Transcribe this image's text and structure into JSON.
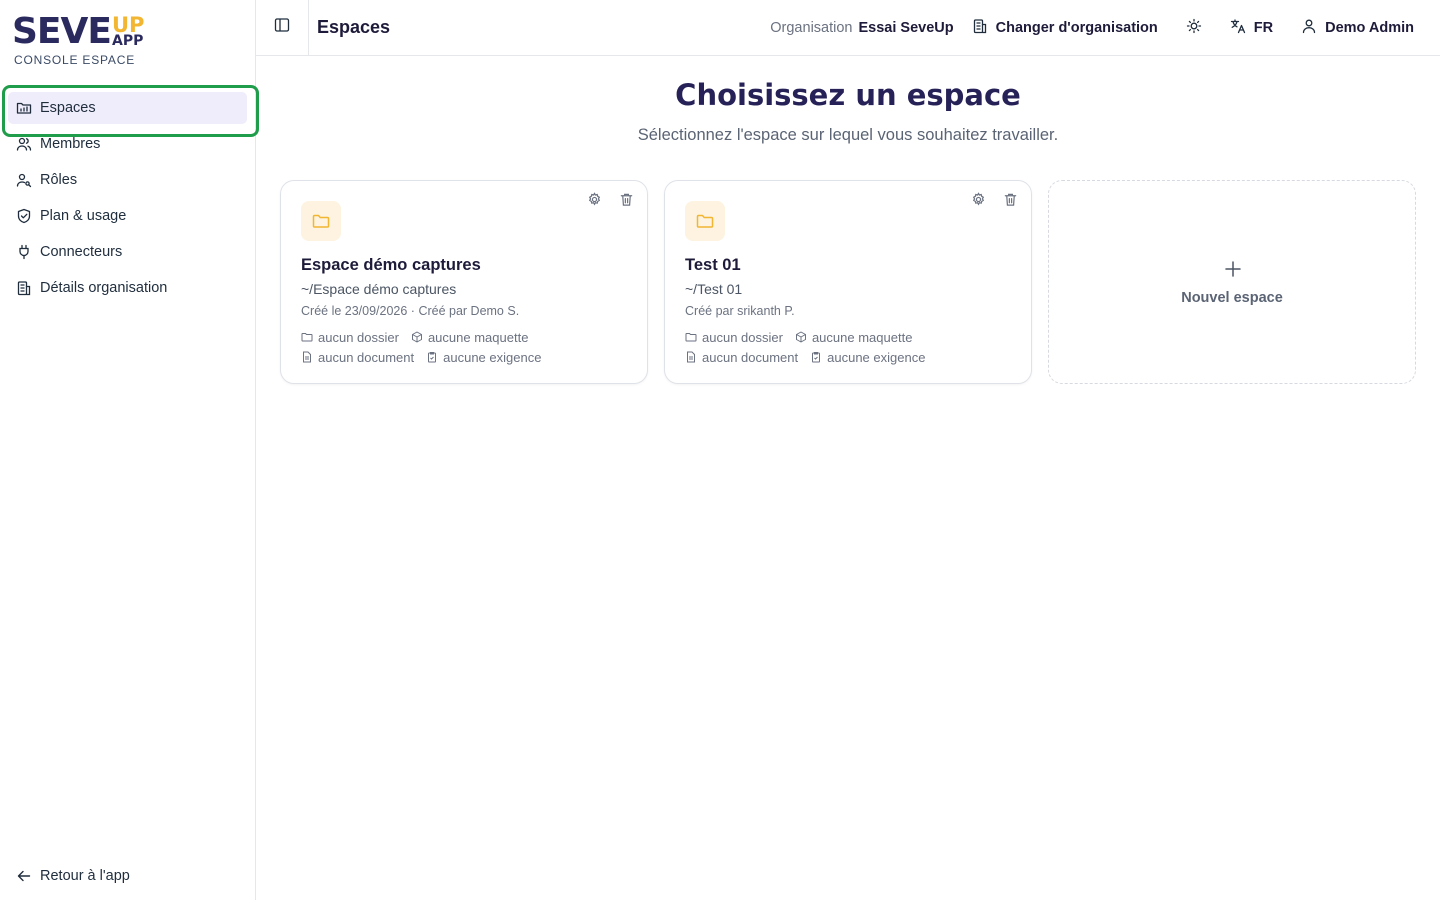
{
  "brand": {
    "name": "SEVE",
    "name_suffix_top": "UP",
    "name_suffix_bottom": "APP",
    "subtitle": "CONSOLE ESPACE",
    "colors": {
      "primary": "#2b2a5e",
      "accent": "#f2b632",
      "active_outline": "#1f9d4a",
      "active_bg": "#efedfb"
    }
  },
  "sidebar": {
    "items": [
      {
        "label": "Espaces",
        "icon": "folder-chart-icon",
        "active": true
      },
      {
        "label": "Membres",
        "icon": "users-icon",
        "active": false
      },
      {
        "label": "Rôles",
        "icon": "user-key-icon",
        "active": false
      },
      {
        "label": "Plan & usage",
        "icon": "shield-check-icon",
        "active": false
      },
      {
        "label": "Connecteurs",
        "icon": "plug-icon",
        "active": false
      },
      {
        "label": "Détails organisation",
        "icon": "building-icon",
        "active": false
      }
    ],
    "back_label": "Retour à l'app"
  },
  "header": {
    "title": "Espaces",
    "org_label": "Organisation",
    "org_name": "Essai SeveUp",
    "change_org_label": "Changer d'organisation",
    "language": "FR",
    "user_name": "Demo Admin"
  },
  "main": {
    "title": "Choisissez un espace",
    "subtitle": "Sélectionnez l'espace sur lequel vous souhaitez travailler.",
    "spaces": [
      {
        "name": "Espace démo captures",
        "path": "~/Espace démo captures",
        "meta": "Créé le 23/09/2026 · Créé par Demo S.",
        "folders": "aucun dossier",
        "mockups": "aucune maquette",
        "documents": "aucun document",
        "requirements": "aucune exigence"
      },
      {
        "name": "Test 01",
        "path": "~/Test 01",
        "meta": "Créé par srikanth P.",
        "folders": "aucun dossier",
        "mockups": "aucune maquette",
        "documents": "aucun document",
        "requirements": "aucune exigence"
      }
    ],
    "new_space_label": "Nouvel espace"
  }
}
